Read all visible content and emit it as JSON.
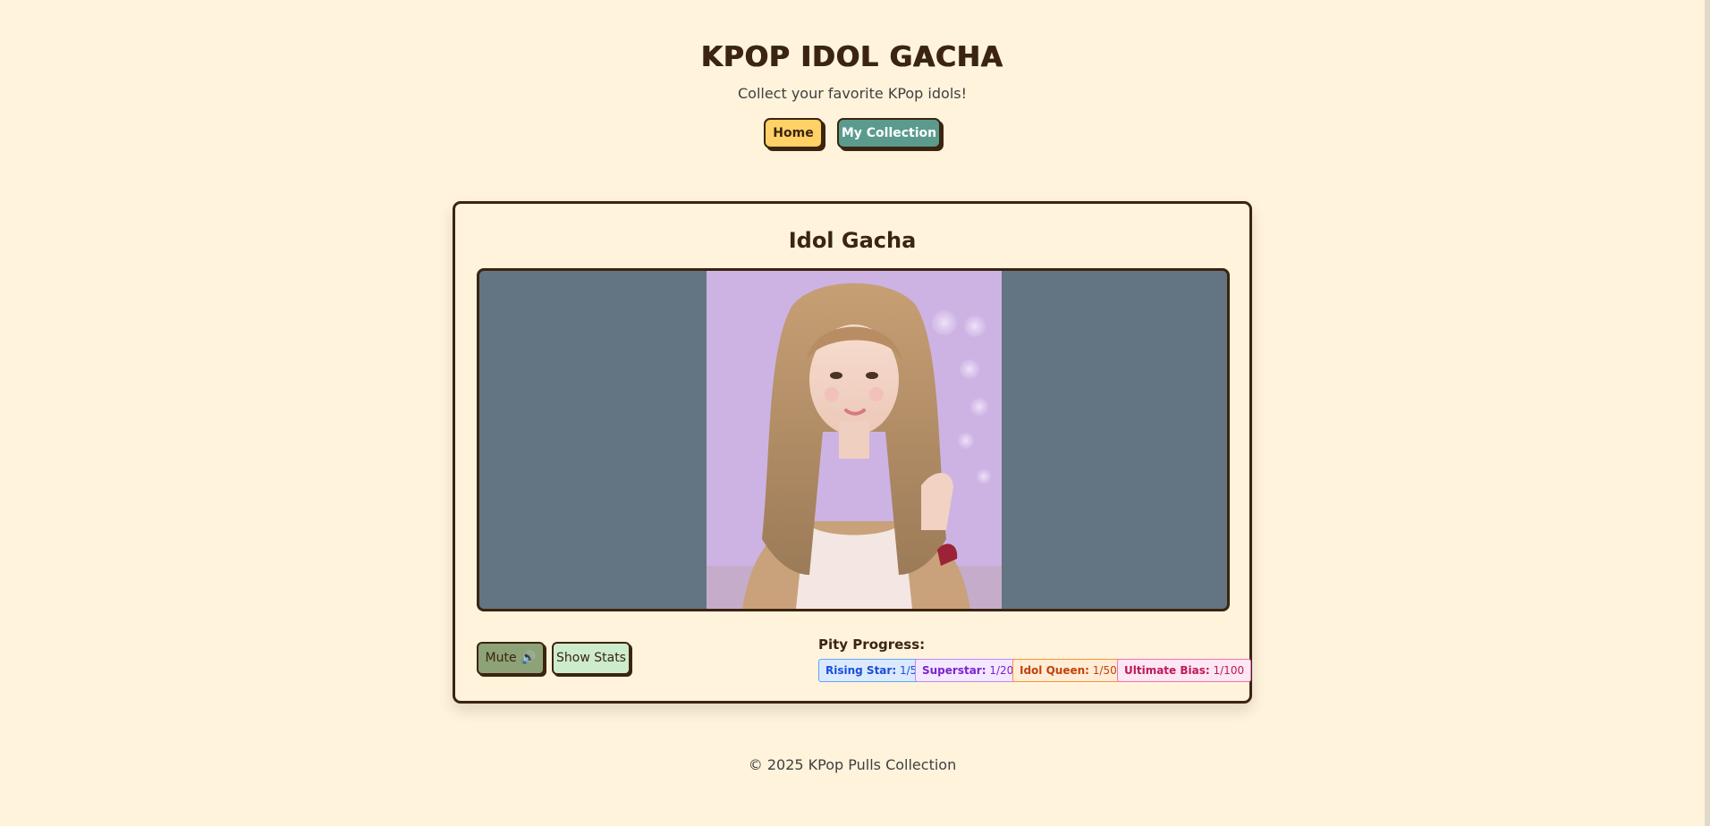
{
  "header": {
    "title": "KPOP IDOL GACHA",
    "subtitle": "Collect your favorite KPop idols!"
  },
  "nav": {
    "home_label": "Home",
    "collection_label": "My Collection"
  },
  "gacha": {
    "title": "Idol Gacha",
    "mute_label": "Mute 🔊",
    "stats_label": "Show Stats"
  },
  "pity": {
    "label": "Pity Progress:",
    "tiers": [
      {
        "name": "Rising Star:",
        "value": "1/5",
        "color": "#1d4ed8",
        "bg": "#dbeafe",
        "border": "#60a5fa"
      },
      {
        "name": "Superstar:",
        "value": "1/20",
        "color": "#7e22ce",
        "bg": "#f3e8ff",
        "border": "#c084fc"
      },
      {
        "name": "Idol Queen:",
        "value": "1/50",
        "color": "#c2410c",
        "bg": "#ffedd5",
        "border": "#fb923c"
      },
      {
        "name": "Ultimate Bias:",
        "value": "1/100",
        "color": "#be185d",
        "bg": "#fce7f3",
        "border": "#f472b6"
      }
    ]
  },
  "footer": {
    "text": "© 2025 KPop Pulls Collection"
  },
  "colors": {
    "background": "#fff3dc",
    "ink": "#3b2410",
    "home_button": "#ffd166",
    "collection_button": "#5a9b8e",
    "viewer_background": "#637582"
  }
}
